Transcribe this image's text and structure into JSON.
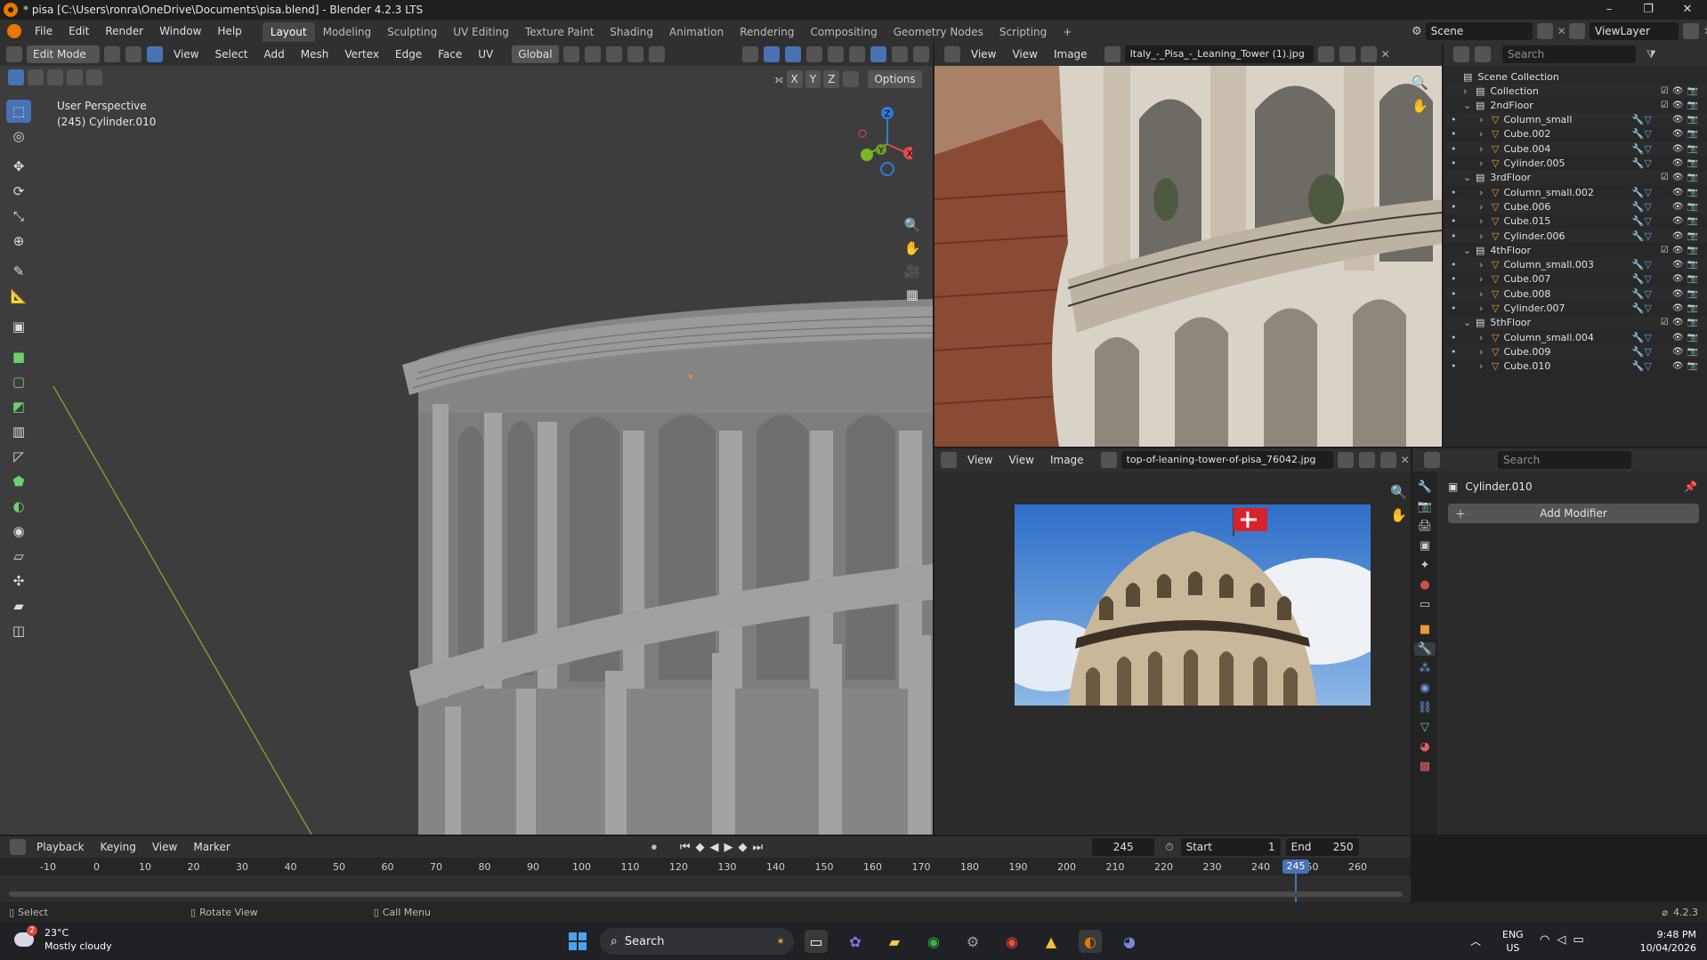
{
  "window": {
    "title": "* pisa [C:\\Users\\ronra\\OneDrive\\Documents\\pisa.blend] - Blender 4.2.3 LTS",
    "minimize": "–",
    "maximize": "❐",
    "close": "✕"
  },
  "menu": {
    "items": [
      "File",
      "Edit",
      "Render",
      "Window",
      "Help"
    ],
    "workspaces": [
      "Layout",
      "Modeling",
      "Sculpting",
      "UV Editing",
      "Texture Paint",
      "Shading",
      "Animation",
      "Rendering",
      "Compositing",
      "Geometry Nodes",
      "Scripting"
    ],
    "active_workspace": "Layout",
    "add_tab": "+",
    "scene": "Scene",
    "view_layer": "ViewLayer"
  },
  "viewport": {
    "mode": "Edit Mode",
    "menus": [
      "View",
      "Select",
      "Add",
      "Mesh",
      "Vertex",
      "Edge",
      "Face",
      "UV"
    ],
    "transform_orientation": "Global",
    "options": "Options",
    "axis_toggles": [
      "X",
      "Y",
      "Z"
    ],
    "overlay_line1": "User Perspective",
    "overlay_line2": "(245) Cylinder.010",
    "gizmo": {
      "z": "Z",
      "y": "Y",
      "x": "X"
    }
  },
  "image_editor_top": {
    "view_menu": "View",
    "menus": [
      "View",
      "Image"
    ],
    "image_name": "Italy_-_Pisa_-_Leaning_Tower (1).jpg"
  },
  "image_editor_bottom": {
    "view_menu": "View",
    "menus": [
      "View",
      "Image"
    ],
    "image_name": "top-of-leaning-tower-of-pisa_76042.jpg"
  },
  "outliner": {
    "search_placeholder": "Search",
    "root": "Scene Collection",
    "rows": [
      {
        "label": "Collection",
        "kind": "collection",
        "indent": 1
      },
      {
        "label": "2ndFloor",
        "kind": "collection",
        "indent": 1
      },
      {
        "label": "Column_small",
        "kind": "mesh",
        "indent": 2
      },
      {
        "label": "Cube.002",
        "kind": "mesh",
        "indent": 2
      },
      {
        "label": "Cube.004",
        "kind": "mesh",
        "indent": 2
      },
      {
        "label": "Cylinder.005",
        "kind": "mesh",
        "indent": 2
      },
      {
        "label": "3rdFloor",
        "kind": "collection",
        "indent": 1
      },
      {
        "label": "Column_small.002",
        "kind": "mesh",
        "indent": 2
      },
      {
        "label": "Cube.006",
        "kind": "mesh",
        "indent": 2
      },
      {
        "label": "Cube.015",
        "kind": "mesh",
        "indent": 2
      },
      {
        "label": "Cylinder.006",
        "kind": "mesh",
        "indent": 2
      },
      {
        "label": "4thFloor",
        "kind": "collection",
        "indent": 1
      },
      {
        "label": "Column_small.003",
        "kind": "mesh",
        "indent": 2
      },
      {
        "label": "Cube.007",
        "kind": "mesh",
        "indent": 2
      },
      {
        "label": "Cube.008",
        "kind": "mesh",
        "indent": 2
      },
      {
        "label": "Cylinder.007",
        "kind": "mesh",
        "indent": 2
      },
      {
        "label": "5thFloor",
        "kind": "collection",
        "indent": 1
      },
      {
        "label": "Column_small.004",
        "kind": "mesh",
        "indent": 2
      },
      {
        "label": "Cube.009",
        "kind": "mesh",
        "indent": 2
      },
      {
        "label": "Cube.010",
        "kind": "mesh",
        "indent": 2
      }
    ]
  },
  "properties": {
    "search_placeholder": "Search",
    "object_name": "Cylinder.010",
    "add_modifier": "Add Modifier"
  },
  "timeline": {
    "menus": [
      "Playback",
      "Keying",
      "View",
      "Marker"
    ],
    "current_frame": "245",
    "start_label": "Start",
    "start_value": "1",
    "end_label": "End",
    "end_value": "250",
    "ticks": [
      "-10",
      "0",
      "10",
      "20",
      "30",
      "40",
      "50",
      "60",
      "70",
      "80",
      "90",
      "100",
      "110",
      "120",
      "130",
      "140",
      "150",
      "160",
      "170",
      "180",
      "190",
      "200",
      "210",
      "220",
      "230",
      "240",
      "250",
      "260"
    ],
    "playhead_label": "245"
  },
  "statusbar": {
    "select": "Select",
    "rotate": "Rotate View",
    "call_menu": "Call Menu",
    "version": "4.2.3"
  },
  "taskbar": {
    "weather_temp": "23°C",
    "weather_desc": "Mostly cloudy",
    "weather_badge": "2",
    "search": "Search",
    "lang": "ENG",
    "region": "US",
    "time": "9:48 PM",
    "date": "10/04/2026"
  },
  "colors": {
    "accent": "#4772b3",
    "mesh_icon": "#e89b3a",
    "blender_orange": "#ea7600",
    "gizmo_x": "#e34a4a",
    "gizmo_y": "#7ab52a",
    "gizmo_z": "#2f7bd8"
  }
}
